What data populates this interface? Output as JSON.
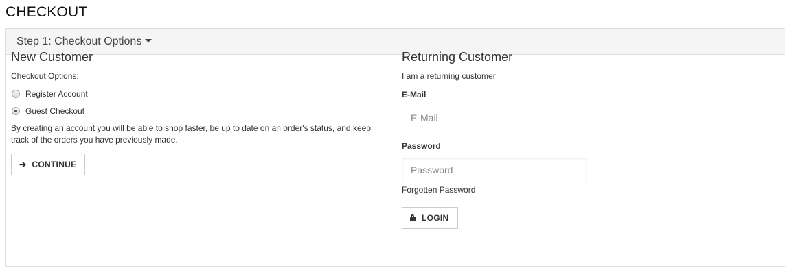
{
  "page": {
    "title": "CHECKOUT"
  },
  "step1": {
    "heading": "Step 1: Checkout Options"
  },
  "new_customer": {
    "title": "New Customer",
    "options_label": "Checkout Options:",
    "options": [
      {
        "label": "Register Account",
        "checked": false
      },
      {
        "label": "Guest Checkout",
        "checked": true
      }
    ],
    "description": "By creating an account you will be able to shop faster, be up to date on an order's status, and keep track of the orders you have previously made.",
    "continue_button": {
      "label": "CONTINUE",
      "icon": "arrow-right-icon",
      "glyph": "➔"
    }
  },
  "returning_customer": {
    "title": "Returning Customer",
    "subtitle": "I am a returning customer",
    "email": {
      "label": "E-Mail",
      "placeholder": "E-Mail",
      "value": ""
    },
    "password": {
      "label": "Password",
      "placeholder": "Password",
      "value": ""
    },
    "forgotten_link": "Forgotten Password",
    "login_button": {
      "label": "LOGIN",
      "icon": "lock-icon"
    }
  }
}
